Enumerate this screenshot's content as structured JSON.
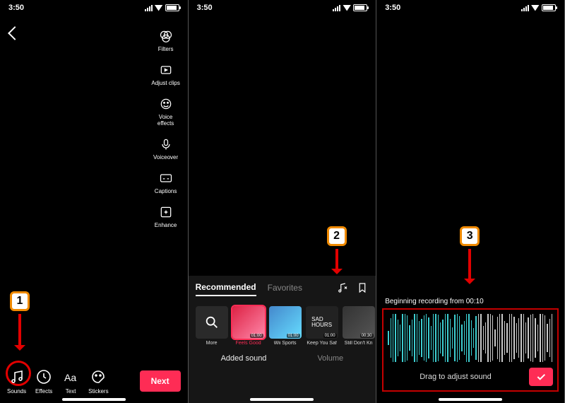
{
  "status": {
    "time": "3:50",
    "location_icon": "location"
  },
  "panel1": {
    "tools": [
      {
        "name": "filters",
        "label": "Filters"
      },
      {
        "name": "adjust-clips",
        "label": "Adjust clips"
      },
      {
        "name": "voice-effects",
        "label": "Voice effects"
      },
      {
        "name": "voiceover",
        "label": "Voiceover"
      },
      {
        "name": "captions",
        "label": "Captions"
      },
      {
        "name": "enhance",
        "label": "Enhance"
      }
    ],
    "bottom": {
      "sounds": "Sounds",
      "effects": "Effects",
      "text": "Text",
      "stickers": "Stickers",
      "next": "Next"
    },
    "step_badge": "1"
  },
  "panel2": {
    "tabs": {
      "recommended": "Recommended",
      "favorites": "Favorites"
    },
    "tracks": [
      {
        "name": "More",
        "duration": ""
      },
      {
        "name": "Feels Good",
        "duration": "01:00",
        "selected": true
      },
      {
        "name": "Wii Sports",
        "duration": "01:00"
      },
      {
        "name": "Keep You Saf",
        "duration": "01:00"
      },
      {
        "name": "Still Don't Kn",
        "duration": "00:30"
      }
    ],
    "secondary": {
      "added": "Added sound",
      "volume": "Volume"
    },
    "step_badge": "2"
  },
  "panel3": {
    "begin_text": "Beginning recording from 00:10",
    "drag_text": "Drag to adjust sound",
    "step_badge": "3"
  }
}
